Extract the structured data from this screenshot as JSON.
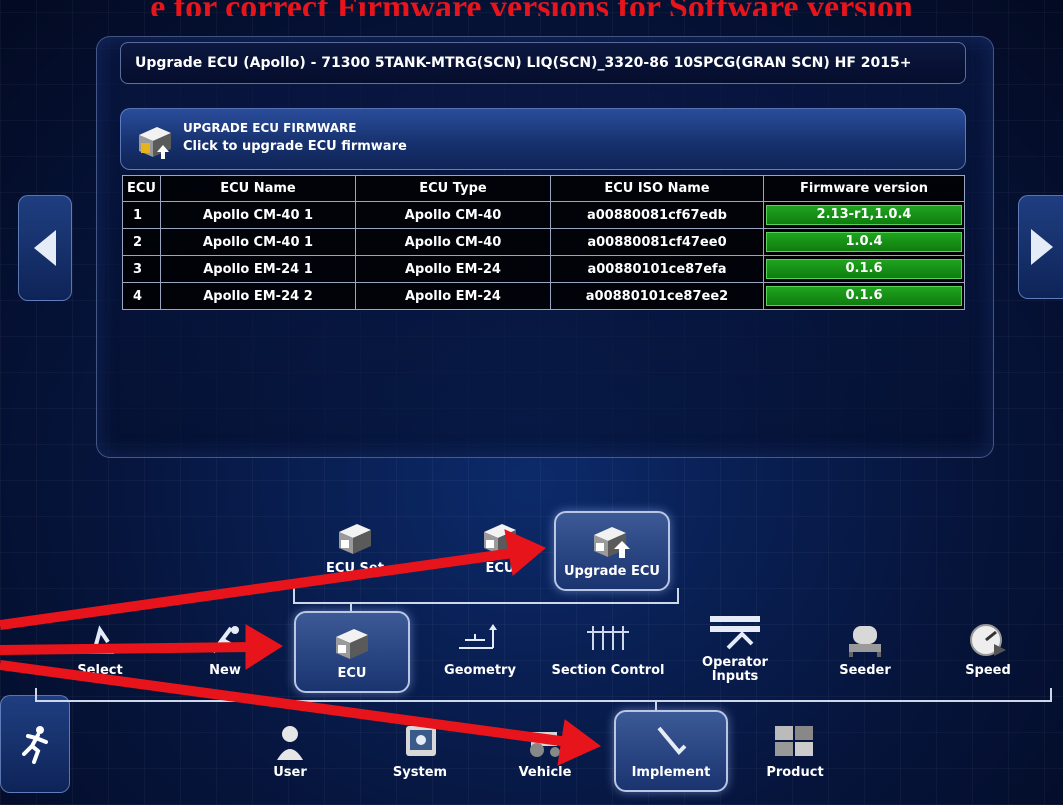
{
  "banner_text": "e for correct Firmware versions for Software version",
  "title_bar": "Upgrade ECU (Apollo) - 71300 5TANK-MTRG(SCN) LIQ(SCN)_3320-86 10SPCG(GRAN SCN) HF 2015+",
  "upgrade_banner": {
    "heading": "UPGRADE ECU FIRMWARE",
    "subtext": "Click to upgrade ECU firmware",
    "icon": "ecu-upgrade-icon"
  },
  "table": {
    "headers": [
      "ECU",
      "ECU Name",
      "ECU Type",
      "ECU ISO Name",
      "Firmware version"
    ],
    "rows": [
      {
        "ecu": "1",
        "name": "Apollo CM-40 1",
        "type": "Apollo CM-40",
        "iso": "a00880081cf67edb",
        "firmware": "2.13-r1,1.0.4"
      },
      {
        "ecu": "2",
        "name": "Apollo CM-40 1",
        "type": "Apollo CM-40",
        "iso": "a00880081cf47ee0",
        "firmware": "1.0.4"
      },
      {
        "ecu": "3",
        "name": "Apollo EM-24 1",
        "type": "Apollo EM-24",
        "iso": "a00880101ce87efa",
        "firmware": "0.1.6"
      },
      {
        "ecu": "4",
        "name": "Apollo EM-24 2",
        "type": "Apollo EM-24",
        "iso": "a00880101ce87ee2",
        "firmware": "0.1.6"
      }
    ]
  },
  "submenu": [
    {
      "label": "ECU Set",
      "icon": "ecu-icon"
    },
    {
      "label": "ECU",
      "icon": "ecu-mapping-icon"
    },
    {
      "label": "Upgrade ECU",
      "icon": "ecu-upgrade-icon",
      "selected": true
    }
  ],
  "implement_menu": [
    {
      "label": "Select",
      "icon": "select-implement-icon"
    },
    {
      "label": "New",
      "icon": "new-implement-icon"
    },
    {
      "label": "ECU",
      "icon": "ecu-icon",
      "selected": true
    },
    {
      "label": "Geometry",
      "icon": "geometry-icon"
    },
    {
      "label": "Section Control",
      "icon": "section-control-icon"
    },
    {
      "label": "Operator\nInputs",
      "icon": "operator-inputs-icon"
    },
    {
      "label": "Seeder",
      "icon": "seeder-icon"
    },
    {
      "label": "Speed",
      "icon": "speed-icon"
    }
  ],
  "main_menu": [
    {
      "label": "User",
      "icon": "user-icon"
    },
    {
      "label": "System",
      "icon": "system-icon"
    },
    {
      "label": "Vehicle",
      "icon": "vehicle-icon"
    },
    {
      "label": "Implement",
      "icon": "implement-icon",
      "selected": true
    },
    {
      "label": "Product",
      "icon": "product-icon"
    }
  ],
  "colors": {
    "firmware_ok": "#1a9a1a",
    "annotation_arrow": "#e8141b",
    "background": "#06153d"
  }
}
